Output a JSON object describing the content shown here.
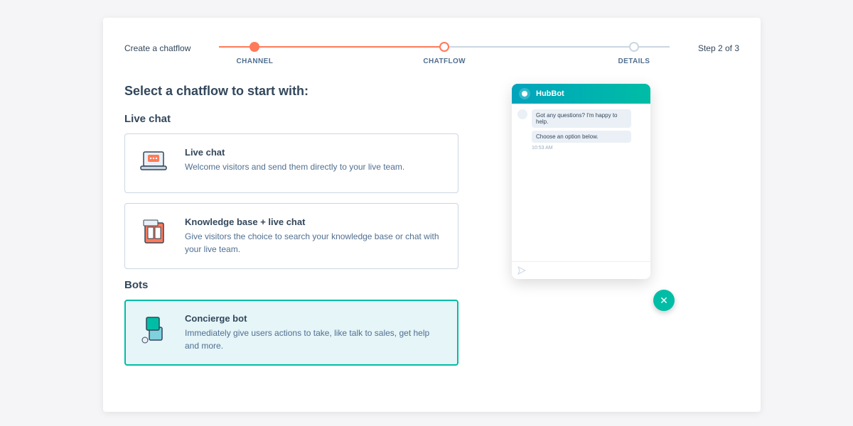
{
  "header": {
    "crumb": "Create a chatflow",
    "step_text": "Step 2 of 3"
  },
  "stepper": {
    "steps": [
      {
        "label": "CHANNEL",
        "state": "done"
      },
      {
        "label": "CHATFLOW",
        "state": "active"
      },
      {
        "label": "DETAILS",
        "state": "pending"
      }
    ]
  },
  "heading": "Select a chatflow to start with:",
  "sections": {
    "live_chat": {
      "label": "Live chat",
      "options": [
        {
          "title": "Live chat",
          "desc": "Welcome visitors and send them directly to your live team.",
          "selected": false,
          "icon": "laptop-chat-icon"
        },
        {
          "title": "Knowledge base + live chat",
          "desc": "Give visitors the choice to search your knowledge base or chat with your live team.",
          "selected": false,
          "icon": "knowledge-base-icon"
        }
      ]
    },
    "bots": {
      "label": "Bots",
      "options": [
        {
          "title": "Concierge bot",
          "desc": "Immediately give users actions to take, like talk to sales, get help and more.",
          "selected": true,
          "icon": "concierge-bot-icon"
        }
      ]
    }
  },
  "preview": {
    "bot_name": "HubBot",
    "messages": [
      "Got any questions? I'm happy to help.",
      "Choose an option below."
    ],
    "timestamp": "10:53 AM",
    "close_label": "✕"
  }
}
